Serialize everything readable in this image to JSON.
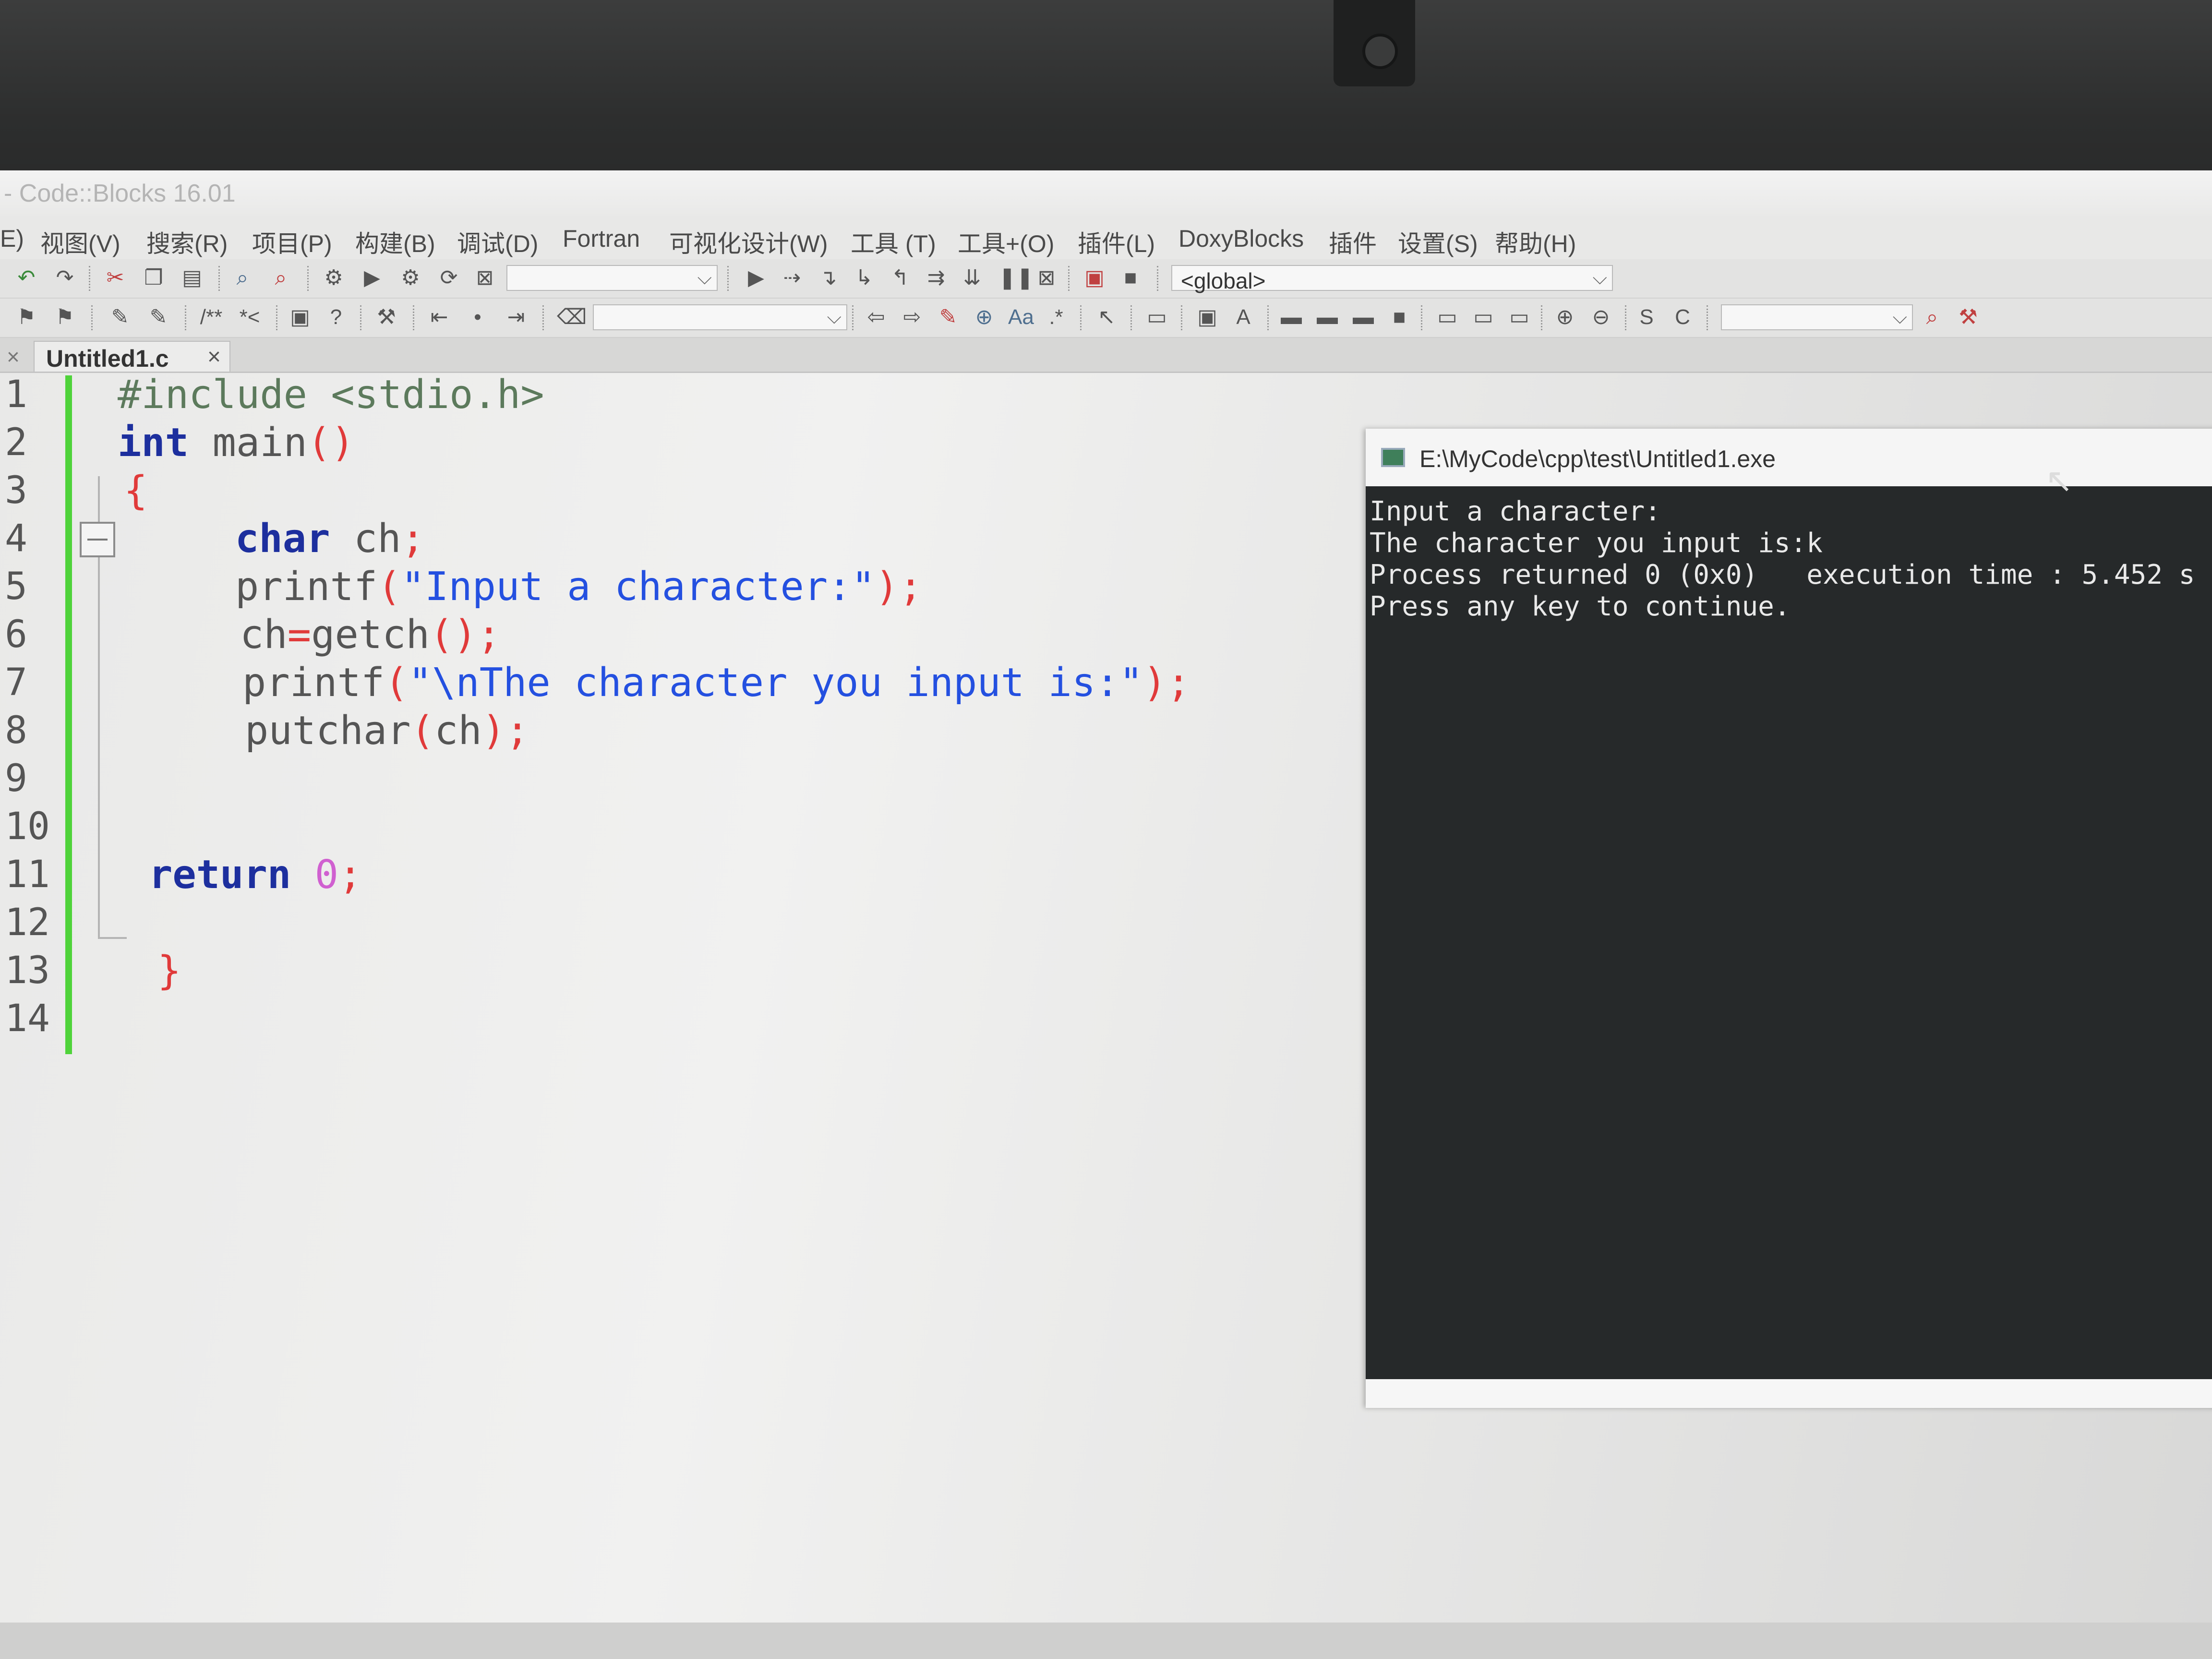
{
  "window": {
    "title": "- Code::Blocks 16.01"
  },
  "menu": [
    "E)",
    "视图(V)",
    "搜索(R)",
    "项目(P)",
    "构建(B)",
    "调试(D)",
    "Fortran",
    "可视化设计(W)",
    "工具 (T)",
    "工具+(O)",
    "插件(L)",
    "DoxyBlocks",
    "插件",
    "设置(S)",
    "帮助(H)"
  ],
  "toolbar": {
    "scope_combo": "<global>",
    "combo_arrow": "⌵"
  },
  "tabs": [
    {
      "label": "Untitled1.c",
      "close": "×"
    }
  ],
  "tab_bar_close": "×",
  "editor": {
    "line_numbers": [
      "1",
      "2",
      "3",
      "4",
      "5",
      "6",
      "7",
      "8",
      "9",
      "10",
      "11",
      "12",
      "13",
      "14"
    ],
    "code": {
      "l1": "#include <stdio.h>",
      "l2_kw": "int",
      "l2_rest": " main",
      "l2_p": "()",
      "l3": "{",
      "l4_kw": "char",
      "l4_rest": " ch",
      "l4_p": ";",
      "l5_fn": "printf",
      "l5_p1": "(",
      "l5_str": "\"Input a character:\"",
      "l5_p2": ");",
      "l6_fn": "ch",
      "l6_eq": "=",
      "l6_call": "getch",
      "l6_p": "();",
      "l7_fn": "printf",
      "l7_p1": "(",
      "l7_str": "\"\\nThe character you input is:\"",
      "l7_p2": ");",
      "l8_fn": "putchar",
      "l8_p1": "(",
      "l8_arg": "ch",
      "l8_p2": ");",
      "l11_kw": "return",
      "l11_num": " 0",
      "l11_p": ";",
      "l13": "}"
    }
  },
  "console": {
    "title": "E:\\MyCode\\cpp\\test\\Untitled1.exe",
    "lines": [
      "Input a character:",
      "The character you input is:k",
      "Process returned 0 (0x0)   execution time : 5.452 s",
      "Press any key to continue."
    ]
  },
  "colors": {
    "keyword": "#1d2f9e",
    "string": "#2450e0",
    "punct": "#e03a3a",
    "number": "#d060d0",
    "preproc": "#5c7a5c",
    "changed_line": "#4fd33a",
    "console_bg": "#26292a"
  }
}
